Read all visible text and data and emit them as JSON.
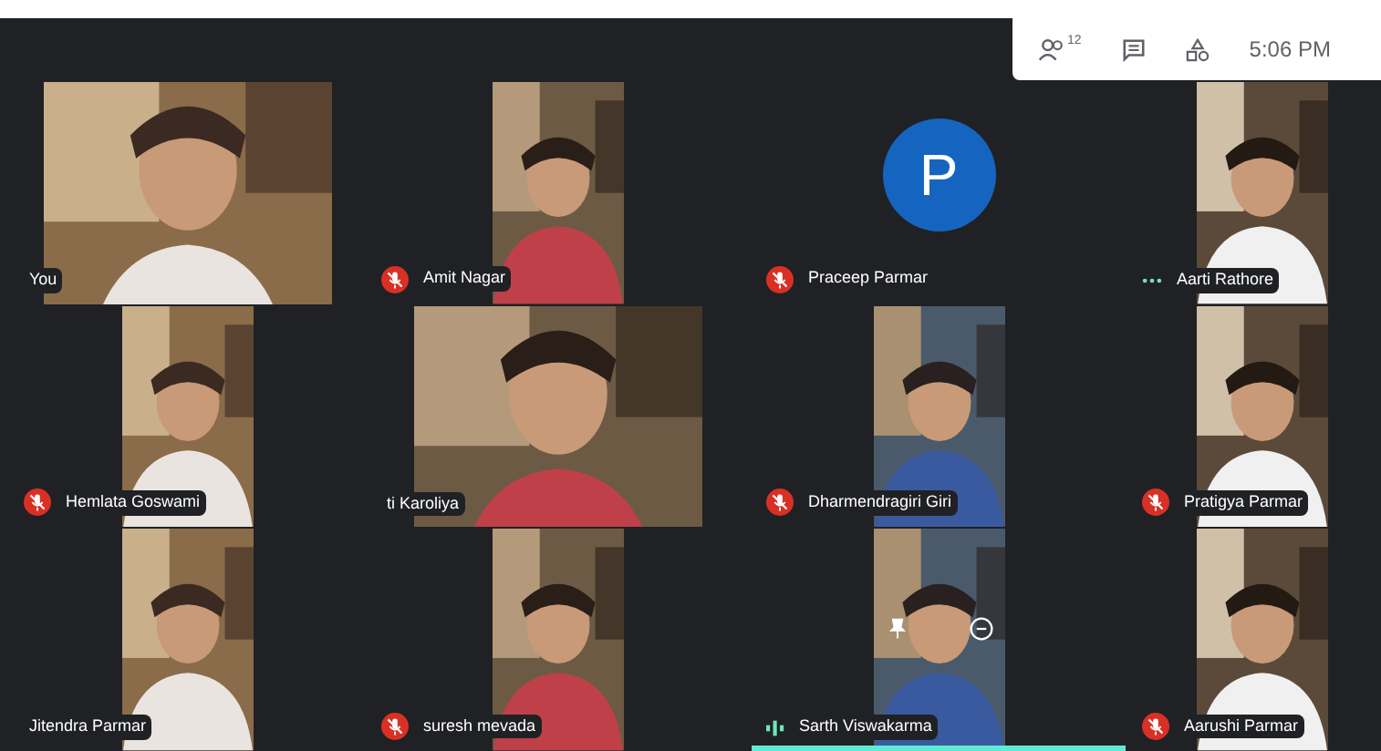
{
  "top_bar": {
    "participant_count": "12",
    "time": "5:06 PM"
  },
  "tiles": [
    {
      "name": "You",
      "kind": "none",
      "wide": true,
      "selected": false,
      "hover": false
    },
    {
      "name": "Amit Nagar",
      "kind": "muted",
      "wide": false,
      "selected": false,
      "hover": false
    },
    {
      "name": "Praceep Parmar",
      "kind": "muted",
      "avatar": "P",
      "selected": false,
      "hover": false
    },
    {
      "name": "Aarti Rathore",
      "kind": "idle",
      "wide": false,
      "selected": false,
      "hover": false
    },
    {
      "name": "Hemlata Goswami",
      "kind": "muted",
      "wide": false,
      "selected": false,
      "hover": false
    },
    {
      "name": "ti Karoliya",
      "kind": "none",
      "wide": true,
      "selected": false,
      "hover": false
    },
    {
      "name": "Dharmendragiri Giri",
      "kind": "muted",
      "wide": false,
      "selected": false,
      "hover": false
    },
    {
      "name": "Pratigya Parmar",
      "kind": "muted",
      "wide": false,
      "selected": false,
      "hover": false
    },
    {
      "name": "Jitendra Parmar",
      "kind": "none",
      "wide": false,
      "selected": false,
      "hover": false
    },
    {
      "name": "suresh mevada",
      "kind": "muted",
      "wide": false,
      "selected": false,
      "hover": false
    },
    {
      "name": "Sarth Viswakarma",
      "kind": "speaking",
      "wide": false,
      "selected": true,
      "hover": true
    },
    {
      "name": "Aarushi Parmar",
      "kind": "muted",
      "wide": false,
      "selected": false,
      "hover": false
    }
  ]
}
